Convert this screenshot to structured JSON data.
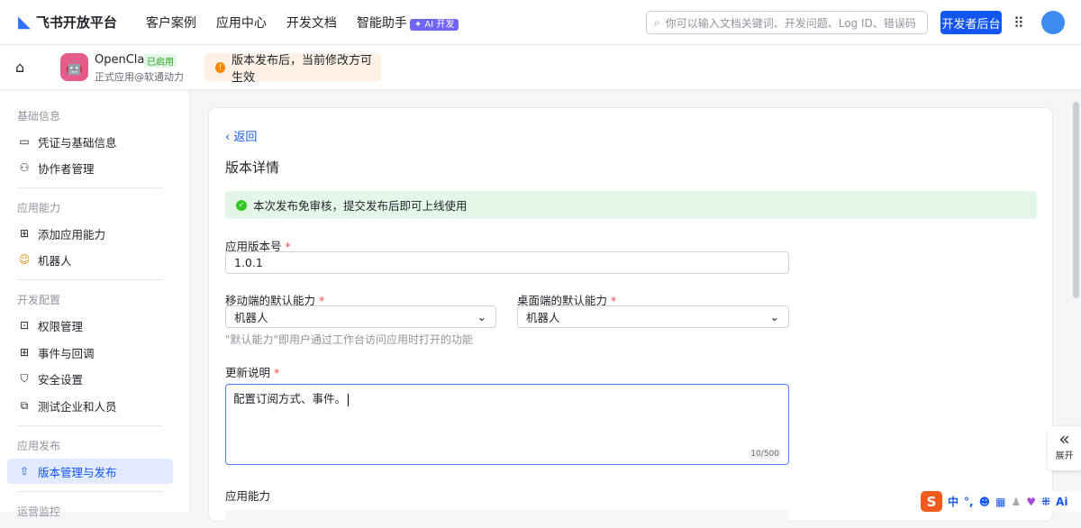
{
  "header": {
    "brand": "飞书开放平台",
    "nav": [
      "客户案例",
      "应用中心",
      "开发文档",
      "智能助手"
    ],
    "ai_badge": "✦ AI 开发",
    "search_placeholder": "你可以输入文档关键词、开发问题、Log ID、错误码",
    "dev_console": "开发者后台"
  },
  "app": {
    "name": "OpenClaw",
    "status": "已启用",
    "subtitle": "正式应用@软通动力",
    "notice": "版本发布后，当前修改方可生效"
  },
  "sidebar": {
    "sections": [
      {
        "title": "基础信息",
        "items": [
          {
            "label": "凭证与基础信息",
            "icon": "▭"
          },
          {
            "label": "协作者管理",
            "icon": "⚇"
          }
        ]
      },
      {
        "title": "应用能力",
        "items": [
          {
            "label": "添加应用能力",
            "icon": "⊞"
          },
          {
            "label": "机器人",
            "icon": "☺"
          }
        ]
      },
      {
        "title": "开发配置",
        "items": [
          {
            "label": "权限管理",
            "icon": "⊡"
          },
          {
            "label": "事件与回调",
            "icon": "⊞"
          },
          {
            "label": "安全设置",
            "icon": "⛉"
          },
          {
            "label": "测试企业和人员",
            "icon": "⧉"
          }
        ]
      },
      {
        "title": "应用发布",
        "items": [
          {
            "label": "版本管理与发布",
            "icon": "⇧"
          }
        ]
      },
      {
        "title": "运营监控",
        "items": []
      }
    ]
  },
  "main": {
    "back": "返回",
    "title": "版本详情",
    "success": "本次发布免审核，提交发布后即可上线使用",
    "version_label": "应用版本号",
    "version_value": "1.0.1",
    "mobile_label": "移动端的默认能力",
    "mobile_value": "机器人",
    "desktop_label": "桌面端的默认能力",
    "desktop_value": "机器人",
    "hint": "\"默认能力\"即用户通过工作台访问应用时打开的功能",
    "notes_label": "更新说明",
    "notes_value": "配置订阅方式、事件。",
    "notes_count": "10/500",
    "capability_label": "应用能力",
    "required": "*"
  },
  "expand": {
    "label": "展开",
    "icon": "«"
  },
  "ime": {
    "lang": "中",
    "punct": "°,",
    "ai": "Ai"
  }
}
